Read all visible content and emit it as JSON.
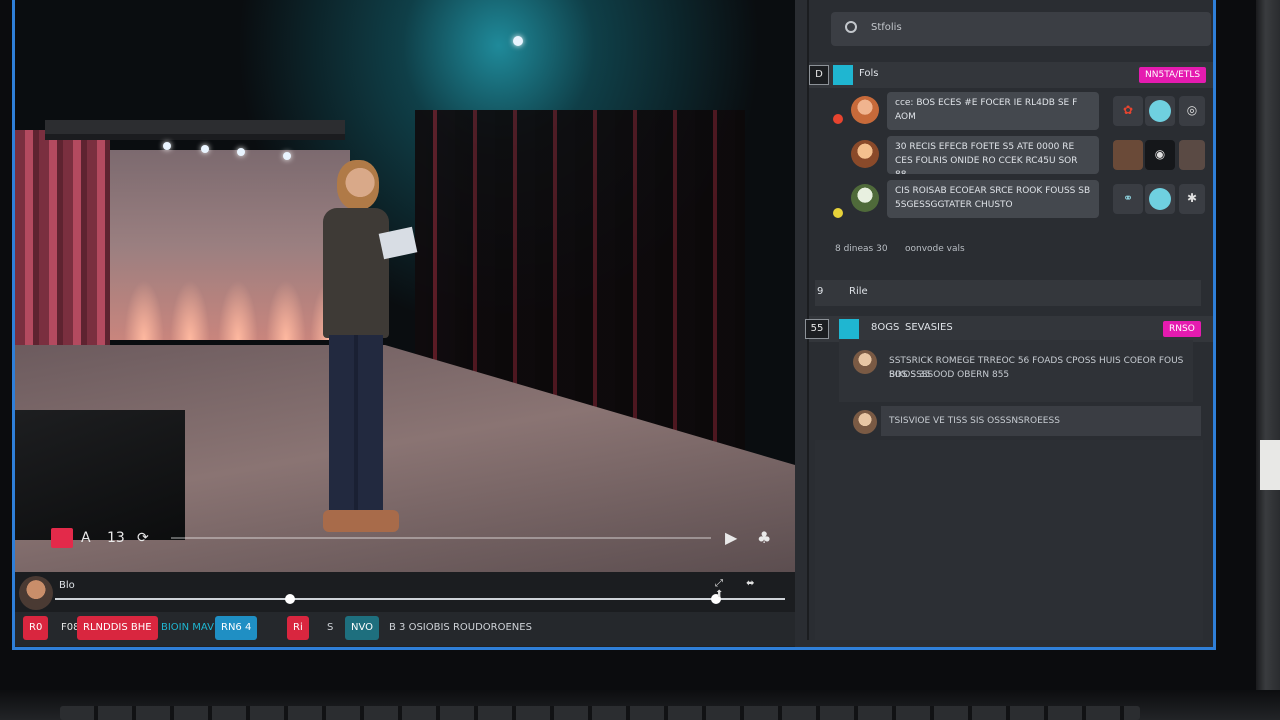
{
  "panel": {
    "search_label": "Stfolis",
    "section1": {
      "title": "Fols",
      "badge": "NN5TA/ETLS",
      "box_label": "D"
    },
    "chats": [
      {
        "text": "cce: BOS ECES #E FOCER IE RL4DB SE F AOM",
        "status_color": "#e8442f"
      },
      {
        "text": "30 RECIS EFECB FOETE S5 ATE 0000 RE CES FOLRIS ONIDE RO CCEK RC45U SOR 88",
        "status_color": ""
      },
      {
        "text": "CIS ROISAB ECOEAR SRCE ROOK FOUSS SB 5SGESSGGTATER CHUSTO",
        "status_color": "#e7d23a"
      }
    ],
    "meta_left": "8 dineas 30",
    "meta_right": "oonvode vals",
    "section2": {
      "prefix": "9",
      "title": "Rile"
    },
    "section3": {
      "title": "8OGS",
      "subtitle": "SEVASIES",
      "badge": "RNSO",
      "box_label": "55"
    },
    "thread_line1": "SSTSRICK ROMEGE TRREOC 56 FOADS CPOSS HUIS COEOR FOUS BIKOS 35",
    "thread_line2": "SOS SSSSOOD OBERN 855",
    "comment_text": "TSISVIOE VE TISS SIS OSSSNSROEESS"
  },
  "video": {
    "player_icons": [
      "A",
      "13",
      "⟳"
    ],
    "player_right_icons": [
      "▶",
      "♣"
    ]
  },
  "timeline": {
    "label": "Blo",
    "icons": "⤢ ⬌ ⬆"
  },
  "toolbar": {
    "items": [
      {
        "label": "R0",
        "bg": "#d9263f",
        "fg": "#ffffff"
      },
      {
        "label": "F08",
        "bg": "transparent",
        "fg": "#e6e6e6"
      },
      {
        "label": "RLNDDIS BHE",
        "bg": "#d9263f",
        "fg": "#ffffff"
      },
      {
        "label": "BIOIN MAVE",
        "bg": "transparent",
        "fg": "#1fb6d1"
      },
      {
        "label": "RN6 4",
        "bg": "#1f8fc4",
        "fg": "#ffffff"
      },
      {
        "label": "Ri",
        "bg": "#d9263f",
        "fg": "#ffffff"
      },
      {
        "label": "S",
        "bg": "transparent",
        "fg": "#cfd3d8"
      },
      {
        "label": "NVO",
        "bg": "#1e6f7e",
        "fg": "#ffffff"
      },
      {
        "label": "B 3 OSIOBIS ROUDOROENES",
        "bg": "transparent",
        "fg": "#cfd3d8"
      }
    ]
  },
  "colors": {
    "accent_blue": "#2f7fd8",
    "accent_pink": "#e51bb0",
    "accent_red": "#d9263f",
    "accent_cyan": "#1fb6d1"
  }
}
